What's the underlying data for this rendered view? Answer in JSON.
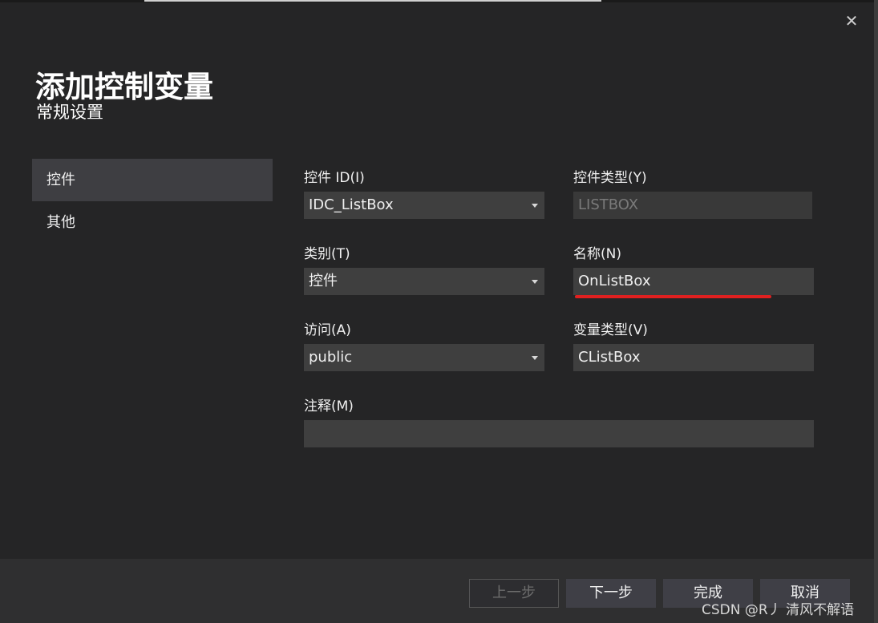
{
  "dialog": {
    "title": "添加控制变量",
    "subtitle": "常规设置",
    "close_glyph": "✕"
  },
  "nav": {
    "items": [
      {
        "label": "控件",
        "active": true
      },
      {
        "label": "其他",
        "active": false
      }
    ]
  },
  "form": {
    "control_id": {
      "label": "控件 ID(I)",
      "value": "IDC_ListBox"
    },
    "control_type": {
      "label": "控件类型(Y)",
      "value": "LISTBOX"
    },
    "category": {
      "label": "类别(T)",
      "value": "控件"
    },
    "name": {
      "label": "名称(N)",
      "value": "OnListBox"
    },
    "access": {
      "label": "访问(A)",
      "value": "public"
    },
    "variable_type": {
      "label": "变量类型(V)",
      "value": "CListBox"
    },
    "comment": {
      "label": "注释(M)",
      "value": ""
    }
  },
  "footer": {
    "prev_label": "上一步",
    "next_label": "下一步",
    "finish_label": "完成",
    "cancel_label": "取消"
  },
  "watermark": "CSDN @R丿 清风不解语",
  "colors": {
    "background": "#252526",
    "field": "#3f3f3f",
    "selected_nav": "#3e3e42",
    "annotation_red": "#e02020"
  }
}
